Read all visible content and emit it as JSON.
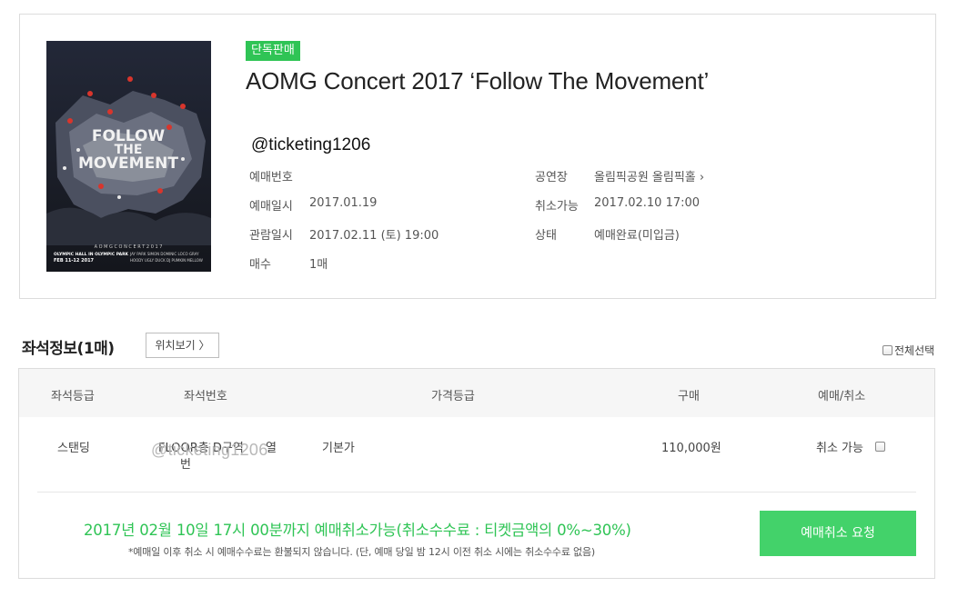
{
  "booking": {
    "badge": "단독판매",
    "title": "AOMG Concert 2017 ‘Follow The Movement’",
    "watermark": "@ticketing1206",
    "poster": {
      "line1": "FOLLOW",
      "line2": "THE",
      "line3": "MOVEMENT",
      "top_text": "A O M G   C O N C E R T   2 0 1 7",
      "venue": "OLYMPIC HALL IN OLYMPIC PARK",
      "dates": "FEB 11-12 2017",
      "artists_1": "JAY PARK  SIMON DOMINIC  LOCO  GRAY",
      "artists_2": "HOODY  UGLY DUCK  DJ PUMKIN  MELLOW"
    },
    "fields": {
      "booking_no_label": "예매번호",
      "booking_no_value": "",
      "booking_date_label": "예매일시",
      "booking_date_value": "2017.01.19",
      "view_date_label": "관람일시",
      "view_date_value": "2017.02.11 (토) 19:00",
      "count_label": "매수",
      "count_value": "1매",
      "venue_label": "공연장",
      "venue_value": "올림픽공원 올림픽홀",
      "venue_arrow": "›",
      "cancel_until_label": "취소가능",
      "cancel_until_value": "2017.02.10 17:00",
      "status_label": "상태",
      "status_value": "예매완료(미입금)"
    }
  },
  "seats": {
    "title": "좌석정보(1매)",
    "location_button": "위치보기 〉",
    "select_all": "전체선택",
    "columns": [
      "좌석등급",
      "좌석번호",
      "가격등급",
      "구매",
      "예매/취소"
    ],
    "rows": [
      {
        "grade": "스탠딩",
        "seat_no_line1": "FLOOR층 D구역",
        "seat_no_col": "열",
        "seat_no_line2": "번",
        "price_grade": "기본가",
        "price": "110,000원",
        "cancel_status": "취소 가능"
      }
    ],
    "row_watermark": "@ticketing1206",
    "notice_main": "2017년 02월 10일 17시 00분까지 예매취소가능(취소수수료 : 티켓금액의 0%~30%)",
    "notice_sub": "*예매일 이후 취소 시 예매수수료는 환불되지 않습니다. (단, 예매 당일 밤 12시 이전 취소 시에는 취소수수료 없음)",
    "cancel_button": "예매취소 요청"
  },
  "colors": {
    "accent_green": "#2fc455",
    "button_green": "#43d26a",
    "border": "#dcdcdc",
    "header_bg": "#f6f6f6"
  }
}
